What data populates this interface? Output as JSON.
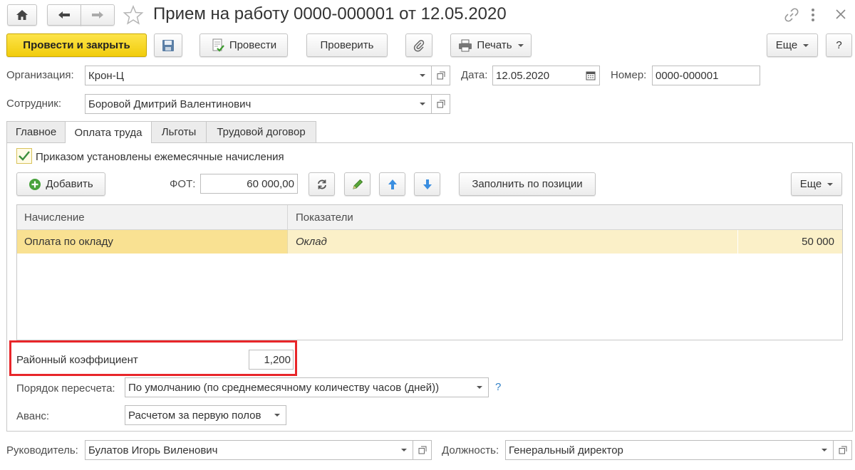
{
  "window": {
    "title": "Прием на работу 0000-000001 от 12.05.2020"
  },
  "toolbar": {
    "post_close": "Провести и закрыть",
    "post": "Провести",
    "check": "Проверить",
    "print": "Печать",
    "more": "Еще",
    "help": "?"
  },
  "header": {
    "org_label": "Организация:",
    "org_value": "Крон-Ц",
    "date_label": "Дата:",
    "date_value": "12.05.2020",
    "number_label": "Номер:",
    "number_value": "0000-000001",
    "employee_label": "Сотрудник:",
    "employee_value": "Боровой Дмитрий Валентинович"
  },
  "tabs": [
    "Главное",
    "Оплата труда",
    "Льготы",
    "Трудовой договор"
  ],
  "active_tab": "Оплата труда",
  "pay": {
    "monthly_checkbox_label": "Приказом установлены ежемесячные начисления",
    "monthly_checked": true,
    "add_button": "Добавить",
    "fot_label": "ФОТ:",
    "fot_value": "60 000,00",
    "fill_by_position": "Заполнить по позиции",
    "more": "Еще",
    "columns": [
      "Начисление",
      "Показатели"
    ],
    "rows": [
      {
        "accrual": "Оплата по окладу",
        "indicator": "Оклад",
        "value": "50 000"
      }
    ],
    "regional_coef_label": "Районный коэффициент",
    "regional_coef_value": "1,200",
    "recalc_label": "Порядок пересчета:",
    "recalc_value": "По умолчанию (по среднемесячному количеству часов (дней))",
    "recalc_help": "?",
    "advance_label": "Аванс:",
    "advance_value": "Расчетом за первую полов"
  },
  "footer": {
    "manager_label": "Руководитель:",
    "manager_value": "Булатов Игорь Виленович",
    "position_label": "Должность:",
    "position_value": "Генеральный директор"
  },
  "colors": {
    "primary_button": "#f5d312",
    "selected_row": "#f9e192",
    "selected_row_light": "#fbf0c8",
    "highlight_frame": "#e8262a"
  }
}
